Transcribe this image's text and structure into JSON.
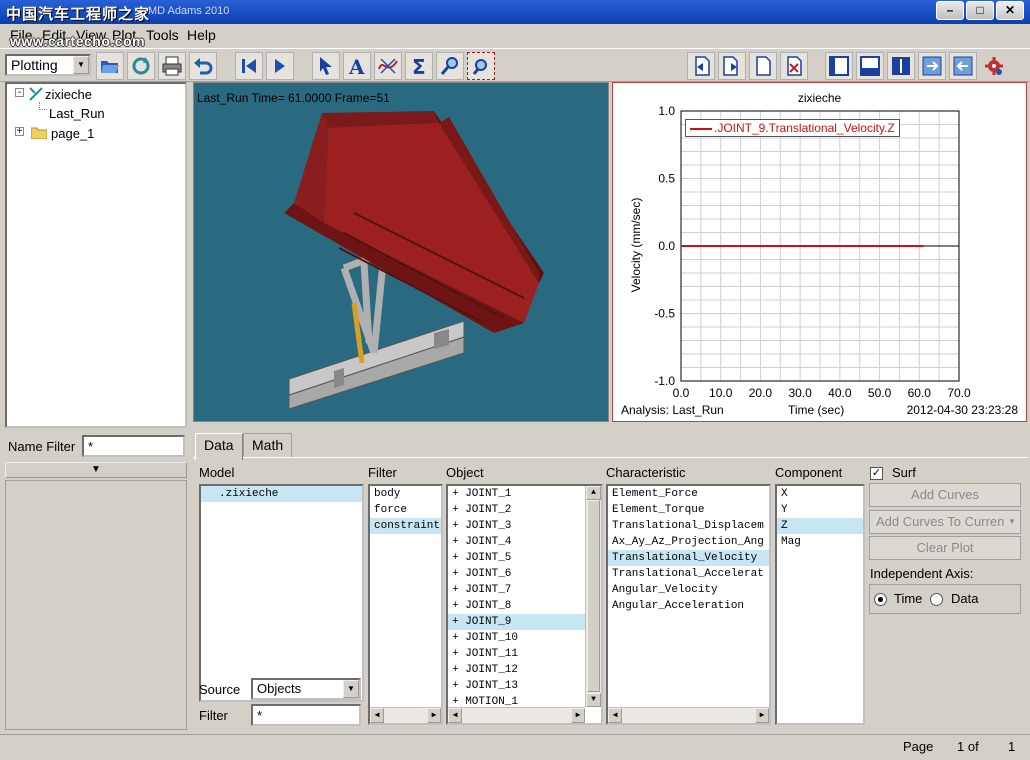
{
  "window": {
    "title": "MD Adams 2010",
    "watermark_cn": "中国汽车工程师之家",
    "watermark_url": "www.cartecho.com",
    "buttons": {
      "minimize": "–",
      "maximize": "□",
      "close": "✕"
    }
  },
  "menu": [
    "File",
    "Edit",
    "View",
    "Plot",
    "Tools",
    "Help"
  ],
  "toolbar": {
    "mode_select": "Plotting",
    "icons": [
      "open-folder-icon",
      "refresh-icon",
      "print-icon",
      "undo-icon",
      "rewind-icon",
      "play-icon",
      "select-arrow-icon",
      "text-icon",
      "curve-icon",
      "sigma-icon",
      "zoom-icon",
      "zoom-box-icon",
      "page-prev-icon",
      "page-next-icon",
      "page-new-icon",
      "page-delete-icon",
      "layout-single-icon",
      "layout-2-icon",
      "layout-4-icon",
      "view-switch-icon",
      "import-icon",
      "settings-gear-icon"
    ]
  },
  "tree": [
    {
      "label": "zixieche",
      "level": 0,
      "icon": "model-icon",
      "expander": "-"
    },
    {
      "label": "Last_Run",
      "level": 1,
      "icon": "",
      "expander": ""
    },
    {
      "label": "page_1",
      "level": 0,
      "icon": "folder-icon",
      "expander": "+"
    }
  ],
  "name_filter": {
    "label": "Name Filter",
    "value": "*"
  },
  "viewport": {
    "label": "Last_Run   Time= 61.0000  Frame=51"
  },
  "plot": {
    "title": "zixieche",
    "legend": ".JOINT_9.Translational_Velocity.Z",
    "footer_left": "Analysis:  Last_Run",
    "footer_right": "2012-04-30 23:23:28",
    "line_color": "#d01010"
  },
  "chart_data": {
    "type": "line",
    "title": "zixieche",
    "xlabel": "Time (sec)",
    "ylabel": "Velocity (mm/sec)",
    "xlim": [
      0.0,
      70.0
    ],
    "ylim": [
      -1.0,
      1.0
    ],
    "x_ticks": [
      "0.0",
      "10.0",
      "20.0",
      "30.0",
      "40.0",
      "50.0",
      "60.0",
      "70.0"
    ],
    "y_ticks": [
      "1.0",
      "0.5",
      "0.0",
      "-0.5",
      "-1.0"
    ],
    "grid": true,
    "legend_position": "top-left",
    "series": [
      {
        "name": ".JOINT_9.Translational_Velocity.Z",
        "x": [
          0.0,
          61.0
        ],
        "y": [
          0.0,
          0.0
        ]
      }
    ]
  },
  "tabs": [
    "Data",
    "Math"
  ],
  "data_panel": {
    "model_header": "Model",
    "models": [
      ".zixieche"
    ],
    "filter_header": "Filter",
    "filters": [
      "body",
      "force",
      "constraint"
    ],
    "object_header": "Object",
    "objects": [
      "+ JOINT_1",
      "+ JOINT_2",
      "+ JOINT_3",
      "+ JOINT_4",
      "+ JOINT_5",
      "+ JOINT_6",
      "+ JOINT_7",
      "+ JOINT_8",
      "+ JOINT_9",
      "+ JOINT_10",
      "+ JOINT_11",
      "+ JOINT_12",
      "+ JOINT_13",
      "+ MOTION_1"
    ],
    "characteristic_header": "Characteristic",
    "characteristics": [
      "Element_Force",
      "Element_Torque",
      "Translational_Displacem",
      "Ax_Ay_Az_Projection_Ang",
      "Translational_Velocity",
      "Translational_Accelerat",
      "Angular_Velocity",
      "Angular_Acceleration"
    ],
    "component_header": "Component",
    "components": [
      "X",
      "Y",
      "Z",
      "Mag"
    ],
    "source_label": "Source",
    "source_value": "Objects",
    "filter_label": "Filter",
    "filter_value": "*",
    "surf_label": "Surf",
    "add_curves": "Add Curves",
    "add_curves_to_current": "Add Curves To Current",
    "clear_plot": "Clear Plot",
    "independent_axis": "Independent Axis:",
    "radio_time": "Time",
    "radio_data": "Data"
  },
  "status": {
    "page_label": "Page",
    "page_of": "1 of",
    "page_total": "1"
  }
}
